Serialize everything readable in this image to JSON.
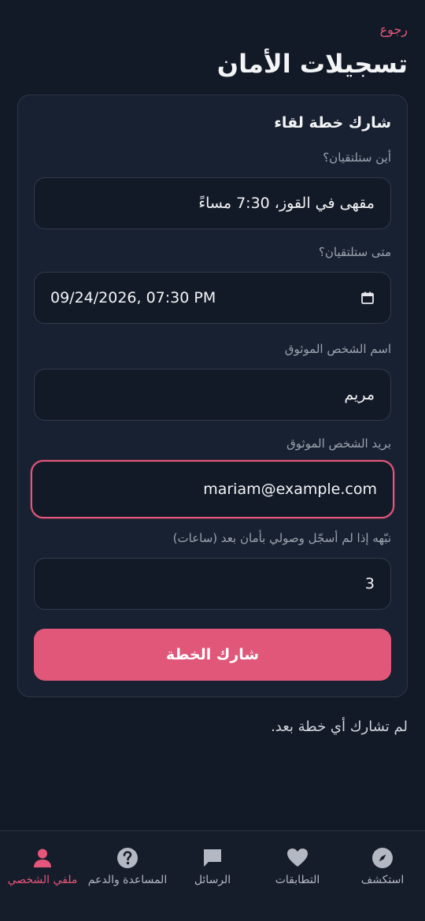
{
  "header": {
    "back_label": "رجوع",
    "title": "تسجيلات الأمان"
  },
  "form": {
    "title": "شارك خطة لقاء",
    "where": {
      "label": "أين ستلتقيان؟",
      "value": "مقهى في القوز، 7:30 مساءً"
    },
    "when": {
      "label": "متى ستلتقيان؟",
      "value": "09/24/2026, 07:30 PM"
    },
    "contact_name": {
      "label": "اسم الشخص الموثوق",
      "value": "مريم"
    },
    "contact_email": {
      "label": "بريد الشخص الموثوق",
      "value": "mariam@example.com"
    },
    "alert_after": {
      "label": "نبّهه إذا لم أسجّل وصولي بأمان بعد (ساعات)",
      "value": "3"
    },
    "submit_label": "شارك الخطة"
  },
  "empty_message": "لم تشارك أي خطة بعد.",
  "nav": {
    "items": [
      {
        "label": "استكشف",
        "icon": "compass-icon",
        "active": false
      },
      {
        "label": "التطابقات",
        "icon": "heart-icon",
        "active": false
      },
      {
        "label": "الرسائل",
        "icon": "chat-icon",
        "active": false
      },
      {
        "label": "المساعدة والدعم",
        "icon": "help-icon",
        "active": false
      },
      {
        "label": "ملفي الشخصي",
        "icon": "person-icon",
        "active": true
      }
    ]
  },
  "colors": {
    "accent": "#e5577a",
    "background": "#131a27",
    "card": "#182131"
  }
}
